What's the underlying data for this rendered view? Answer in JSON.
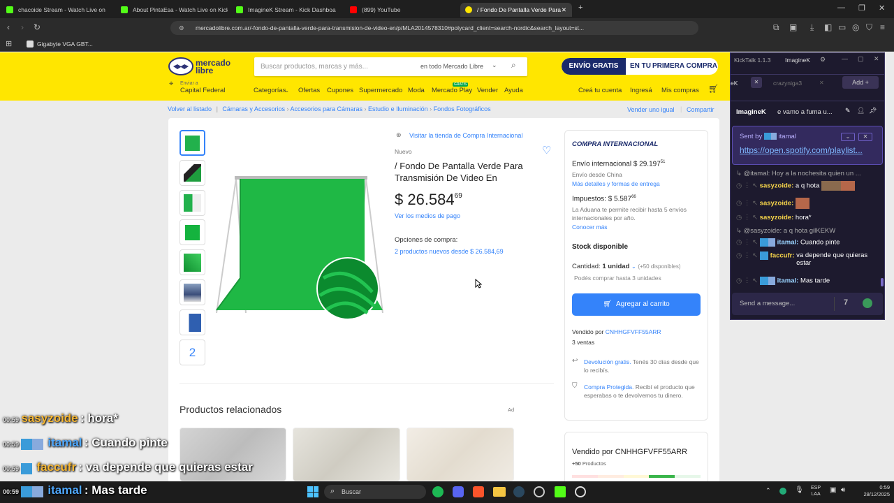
{
  "browser": {
    "tabs": [
      {
        "title": "chacoide Stream - Watch Live on"
      },
      {
        "title": "About PintaEsa - Watch Live on Kick"
      },
      {
        "title": "ImagineK Stream - Kick Dashboa"
      },
      {
        "title": "(899) YouTube"
      },
      {
        "title": "/ Fondo De Pantalla Verde Para"
      }
    ],
    "url": "mercadolibre.com.ar/-fondo-de-pantalla-verde-para-transmision-de-video-en/p/MLA2014578310#polycard_client=search-nordic&search_layout=st...",
    "bookmark": "Gigabyte VGA GBT..."
  },
  "ml": {
    "logo_line1": "mercado",
    "logo_line2": "libre",
    "search_placeholder": "Buscar productos, marcas y más...",
    "search_scope": "en todo Mercado Libre",
    "envio_badge": "ENVÍO GRATIS",
    "envio_text1": "EN TU",
    "envio_text2": "PRIMERA COMPRA",
    "location_l1": "Enviar a",
    "location_l2": "Capital Federal",
    "nav": [
      "Categorías",
      "Ofertas",
      "Cupones",
      "Supermercado",
      "Moda",
      "Mercado Play",
      "Vender",
      "Ayuda"
    ],
    "play_badge": "GRATIS",
    "user_nav": [
      "Creá tu cuenta",
      "Ingresá",
      "Mis compras"
    ],
    "breadcrumb": [
      "Volver al listado",
      "Cámaras y Accesorios",
      "Accesorios para Cámaras",
      "Estudio e Iluminación",
      "Fondos Fotográficos"
    ],
    "sell_same": "Vender uno igual",
    "share": "Compartir",
    "thumbs_more": "2",
    "store_link": "Visitar la tienda de Compra Internacional",
    "condition": "Nuevo",
    "title": "/ Fondo De Pantalla Verde Para Transmisión De Video En",
    "price_int": "$ 26.584",
    "price_cents": "69",
    "pay_methods": "Ver los medios de pago",
    "options_label": "Opciones de compra:",
    "options_link": "2 productos nuevos desde $ 26.584,69",
    "related_title": "Productos relacionados",
    "ad": "Ad",
    "buy": {
      "heading": "COMPRA INTERNACIONAL",
      "shipping": "Envío internacional $ 29.197",
      "shipping_cents": "51",
      "ships_from": "Envío desde China",
      "more_details": "Más detalles y formas de entrega",
      "taxes": "Impuestos: $ 5.587",
      "taxes_cents": "66",
      "customs": "La Aduana te permite recibir hasta 5 envíos internacionales por año.",
      "know_more": "Conocer más",
      "stock": "Stock disponible",
      "qty_label": "Cantidad:",
      "qty_value": "1 unidad",
      "qty_avail": "(+50 disponibles)",
      "qty_note": "Podés comprar hasta 3 unidades",
      "add_cart": "Agregar al carrito",
      "sold_by_label": "Vendido por",
      "seller": "CNHHGFVFF55ARR",
      "sales": "3 ventas",
      "return_link": "Devolución gratis.",
      "return_text": "Tenés 30 días desde que lo recibís.",
      "protect_link": "Compra Protegida.",
      "protect_text": "Recibí el producto que esperabas o te devolvemos tu dinero."
    },
    "seller_box": {
      "title": "Vendido por CNHHGFVFF55ARR",
      "products": "+50",
      "products_label": "Productos"
    }
  },
  "kicktalk": {
    "title": "KickTalk 1.1.3",
    "user": "ImagineK",
    "tab1": "eK",
    "tab2": "crazyniga3",
    "add": "Add",
    "channel": "ImagineK",
    "stream_title": "e vamo a fuma u...",
    "sent_by": "Sent by",
    "sent_user": "itamal",
    "link": "https://open.spotify.com/playlist...",
    "messages": [
      {
        "user": "@itamal:",
        "text": "Hoy a la nochesita quien un ..."
      },
      {
        "user": "sasyzoide:",
        "text": "a q hota"
      },
      {
        "user": "sasyzoide:",
        "text": ""
      },
      {
        "user": "sasyzoide:",
        "text": "hora*"
      },
      {
        "user": "@sasyzoide:",
        "text": "a q hota gilKEKW"
      },
      {
        "user": "itamal:",
        "text": "Cuando pinte"
      },
      {
        "user": "faccufr:",
        "text": "va depende que quieras estar"
      },
      {
        "user": "itamal:",
        "text": "Mas tarde"
      }
    ],
    "input_placeholder": "Send a message..."
  },
  "overlay": [
    {
      "time": "00:59",
      "user": "sasyzoide",
      "text": ": hora*"
    },
    {
      "time": "00:59",
      "user": "itamal",
      "text": ": Cuando pinte"
    },
    {
      "time": "00:59",
      "user": "faccufr",
      "text": ": va depende que quieras estar"
    },
    {
      "time": "00:59",
      "user": "itamal",
      "text": ": Mas tarde"
    }
  ],
  "taskbar": {
    "search": "Buscar",
    "lang1": "ESP",
    "lang2": "LAA",
    "time": "0:59",
    "date": "28/12/2025"
  }
}
